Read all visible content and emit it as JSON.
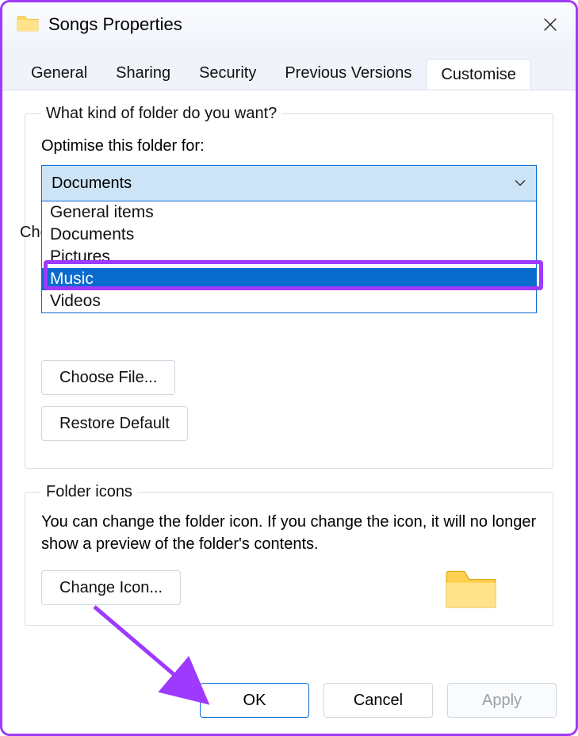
{
  "title": "Songs Properties",
  "tabs": [
    "General",
    "Sharing",
    "Security",
    "Previous Versions",
    "Customise"
  ],
  "active_tab": 4,
  "group1": {
    "legend": "What kind of folder do you want?",
    "sub_label": "Optimise this folder for:",
    "combo": {
      "selected": "Documents",
      "options": [
        "General items",
        "Documents",
        "Pictures",
        "Music",
        "Videos"
      ],
      "highlight_index": 3
    },
    "behind_text": "Choose a file to show on this folder icon.",
    "choose_file": "Choose File...",
    "restore_default": "Restore Default"
  },
  "group2": {
    "legend": "Folder icons",
    "desc": "You can change the folder icon. If you change the icon, it will no longer show a preview of the folder's contents.",
    "change_icon": "Change Icon..."
  },
  "buttons": {
    "ok": "OK",
    "cancel": "Cancel",
    "apply": "Apply"
  },
  "colors": {
    "accent": "#0a6bcf",
    "annotation": "#9e3aff"
  }
}
